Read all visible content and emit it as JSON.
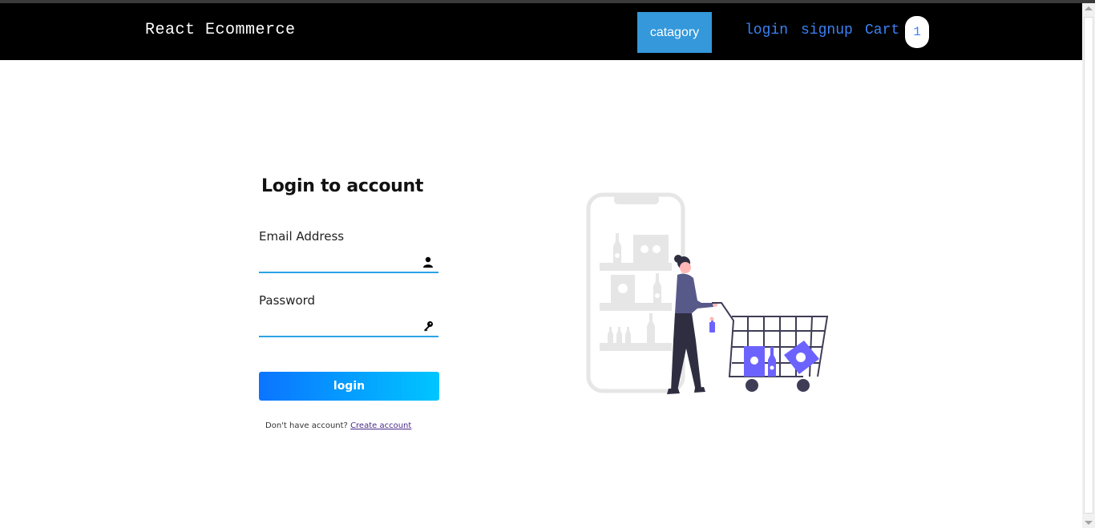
{
  "navbar": {
    "brand": "React Ecommerce",
    "category_button": "catagory",
    "links": {
      "login": "login",
      "signup": "signup",
      "cart": "Cart"
    },
    "cart_count": "1"
  },
  "login_form": {
    "title": "Login to account",
    "email_label": "Email Address",
    "email_value": "",
    "password_label": "Password",
    "password_value": "",
    "submit_label": "login",
    "no_account_text": "Don't have account?",
    "create_account_link": "Create account"
  },
  "icons": {
    "email_icon": "user-icon",
    "password_icon": "key-icon"
  },
  "colors": {
    "navbar_bg": "#000000",
    "category_button_bg": "#3498db",
    "link_color": "#3b82f6",
    "input_underline": "#2ba3e6",
    "button_gradient_start": "#0b74ff",
    "button_gradient_end": "#00c6ff",
    "illustration_accent": "#6c63ff"
  }
}
